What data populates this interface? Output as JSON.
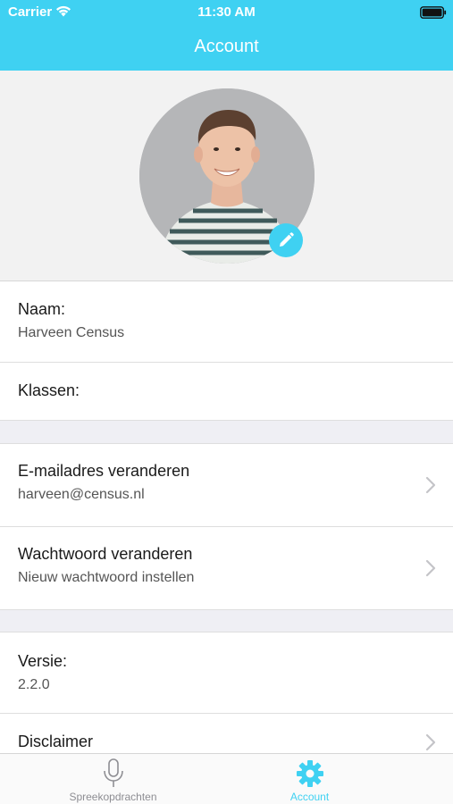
{
  "status_bar": {
    "carrier": "Carrier",
    "time": "11:30 AM"
  },
  "nav": {
    "title": "Account"
  },
  "profile": {
    "avatar_alt": "profile photo",
    "edit_icon": "pencil-icon"
  },
  "rows": {
    "naam": {
      "label": "Naam:",
      "value": "Harveen Census"
    },
    "klassen": {
      "label": "Klassen:"
    },
    "email": {
      "label": "E-mailadres veranderen",
      "value": "harveen@census.nl"
    },
    "wachtwoord": {
      "label": "Wachtwoord veranderen",
      "value": "Nieuw wachtwoord instellen"
    },
    "versie": {
      "label": "Versie:",
      "value": "2.2.0"
    },
    "disclaimer": {
      "label": "Disclaimer"
    }
  },
  "tabs": [
    {
      "label": "Spreekopdrachten",
      "icon": "microphone-icon",
      "active": false
    },
    {
      "label": "Account",
      "icon": "gear-icon",
      "active": true
    }
  ],
  "colors": {
    "accent": "#3fd1f2",
    "inactive": "#8e8e93"
  }
}
